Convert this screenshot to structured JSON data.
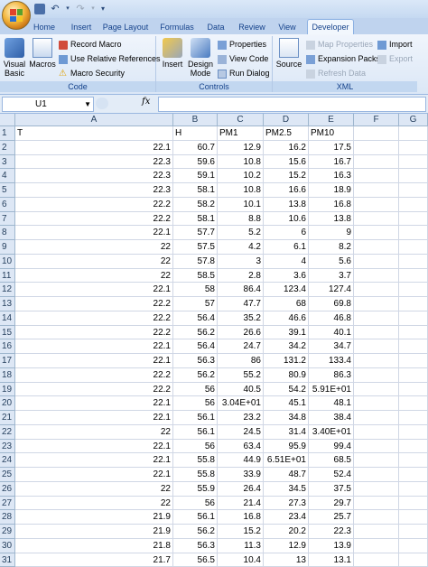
{
  "colors": {
    "accent": "#15428b",
    "ribbon_bg": "#dbe7f6",
    "grid_line": "#d0d7e5",
    "header_bg": "#dde7f5"
  },
  "quick_access": {
    "icons": [
      "save-icon",
      "undo-icon",
      "redo-icon",
      "customize-icon"
    ]
  },
  "tabs": [
    {
      "label": "Home"
    },
    {
      "label": "Insert"
    },
    {
      "label": "Page Layout"
    },
    {
      "label": "Formulas"
    },
    {
      "label": "Data"
    },
    {
      "label": "Review"
    },
    {
      "label": "View"
    },
    {
      "label": "Developer"
    }
  ],
  "active_tab": "Developer",
  "ribbon": {
    "code": {
      "label": "Code",
      "visual_basic": "Visual Basic",
      "macros": "Macros",
      "record_macro": "Record Macro",
      "relative_refs": "Use Relative References",
      "macro_security": "Macro Security"
    },
    "controls": {
      "label": "Controls",
      "insert": "Insert",
      "design_mode": "Design Mode",
      "properties": "Properties",
      "view_code": "View Code",
      "run_dialog": "Run Dialog"
    },
    "xml": {
      "label": "XML",
      "source": "Source",
      "map_properties": "Map Properties",
      "expansion_packs": "Expansion Packs",
      "refresh_data": "Refresh Data",
      "import": "Import",
      "export": "Export"
    }
  },
  "formula_bar": {
    "name_box": "U1",
    "fx": "fx",
    "formula": ""
  },
  "columns": [
    "A",
    "B",
    "C",
    "D",
    "E",
    "F",
    "G"
  ],
  "rows": [
    {
      "n": "1",
      "a": "T",
      "b": "H",
      "c": "PM1",
      "d": "PM2.5",
      "e": "PM10"
    },
    {
      "n": "2",
      "a": "22.1",
      "b": "60.7",
      "c": "12.9",
      "d": "16.2",
      "e": "17.5"
    },
    {
      "n": "3",
      "a": "22.3",
      "b": "59.6",
      "c": "10.8",
      "d": "15.6",
      "e": "16.7"
    },
    {
      "n": "4",
      "a": "22.3",
      "b": "59.1",
      "c": "10.2",
      "d": "15.2",
      "e": "16.3"
    },
    {
      "n": "5",
      "a": "22.3",
      "b": "58.1",
      "c": "10.8",
      "d": "16.6",
      "e": "18.9"
    },
    {
      "n": "6",
      "a": "22.2",
      "b": "58.2",
      "c": "10.1",
      "d": "13.8",
      "e": "16.8"
    },
    {
      "n": "7",
      "a": "22.2",
      "b": "58.1",
      "c": "8.8",
      "d": "10.6",
      "e": "13.8"
    },
    {
      "n": "8",
      "a": "22.1",
      "b": "57.7",
      "c": "5.2",
      "d": "6",
      "e": "9"
    },
    {
      "n": "9",
      "a": "22",
      "b": "57.5",
      "c": "4.2",
      "d": "6.1",
      "e": "8.2"
    },
    {
      "n": "10",
      "a": "22",
      "b": "57.8",
      "c": "3",
      "d": "4",
      "e": "5.6"
    },
    {
      "n": "11",
      "a": "22",
      "b": "58.5",
      "c": "2.8",
      "d": "3.6",
      "e": "3.7"
    },
    {
      "n": "12",
      "a": "22.1",
      "b": "58",
      "c": "86.4",
      "d": "123.4",
      "e": "127.4"
    },
    {
      "n": "13",
      "a": "22.2",
      "b": "57",
      "c": "47.7",
      "d": "68",
      "e": "69.8"
    },
    {
      "n": "14",
      "a": "22.2",
      "b": "56.4",
      "c": "35.2",
      "d": "46.6",
      "e": "46.8"
    },
    {
      "n": "15",
      "a": "22.2",
      "b": "56.2",
      "c": "26.6",
      "d": "39.1",
      "e": "40.1"
    },
    {
      "n": "16",
      "a": "22.1",
      "b": "56.4",
      "c": "24.7",
      "d": "34.2",
      "e": "34.7"
    },
    {
      "n": "17",
      "a": "22.1",
      "b": "56.3",
      "c": "86",
      "d": "131.2",
      "e": "133.4"
    },
    {
      "n": "18",
      "a": "22.2",
      "b": "56.2",
      "c": "55.2",
      "d": "80.9",
      "e": "86.3"
    },
    {
      "n": "19",
      "a": "22.2",
      "b": "56",
      "c": "40.5",
      "d": "54.2",
      "e": "5.91E+01"
    },
    {
      "n": "20",
      "a": "22.1",
      "b": "56",
      "c": "3.04E+01",
      "d": "45.1",
      "e": "48.1"
    },
    {
      "n": "21",
      "a": "22.1",
      "b": "56.1",
      "c": "23.2",
      "d": "34.8",
      "e": "38.4"
    },
    {
      "n": "22",
      "a": "22",
      "b": "56.1",
      "c": "24.5",
      "d": "31.4",
      "e": "3.40E+01"
    },
    {
      "n": "23",
      "a": "22.1",
      "b": "56",
      "c": "63.4",
      "d": "95.9",
      "e": "99.4"
    },
    {
      "n": "24",
      "a": "22.1",
      "b": "55.8",
      "c": "44.9",
      "d": "6.51E+01",
      "e": "68.5"
    },
    {
      "n": "25",
      "a": "22.1",
      "b": "55.8",
      "c": "33.9",
      "d": "48.7",
      "e": "52.4"
    },
    {
      "n": "26",
      "a": "22",
      "b": "55.9",
      "c": "26.4",
      "d": "34.5",
      "e": "37.5"
    },
    {
      "n": "27",
      "a": "22",
      "b": "56",
      "c": "21.4",
      "d": "27.3",
      "e": "29.7"
    },
    {
      "n": "28",
      "a": "21.9",
      "b": "56.1",
      "c": "16.8",
      "d": "23.4",
      "e": "25.7"
    },
    {
      "n": "29",
      "a": "21.9",
      "b": "56.2",
      "c": "15.2",
      "d": "20.2",
      "e": "22.3"
    },
    {
      "n": "30",
      "a": "21.8",
      "b": "56.3",
      "c": "11.3",
      "d": "12.9",
      "e": "13.9"
    },
    {
      "n": "31",
      "a": "21.7",
      "b": "56.5",
      "c": "10.4",
      "d": "13",
      "e": "13.1"
    }
  ]
}
